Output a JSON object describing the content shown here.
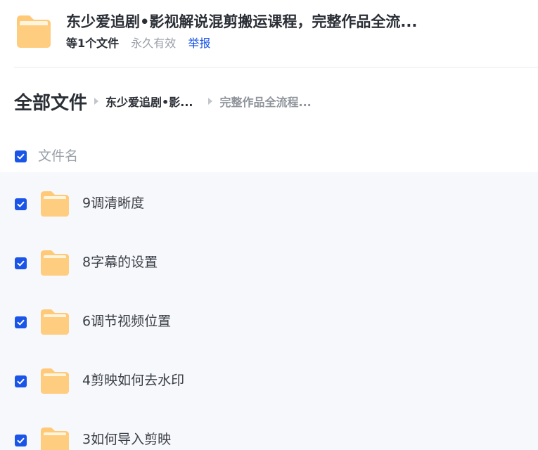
{
  "share": {
    "title": "东少爱追剧•影视解说混剪搬运课程，完整作品全流...",
    "file_count": "等1个文件",
    "expiry": "永久有效",
    "report_label": "举报"
  },
  "breadcrumb": {
    "root": "全部文件",
    "items": [
      "东少爱追剧•影...",
      "完整作品全流程..."
    ]
  },
  "list": {
    "column_name": "文件名",
    "select_all_checked": true,
    "rows": [
      {
        "name": "9调清晰度",
        "checked": true
      },
      {
        "name": "8字幕的设置",
        "checked": true
      },
      {
        "name": "6调节视频位置",
        "checked": true
      },
      {
        "name": "4剪映如何去水印",
        "checked": true
      },
      {
        "name": "3如何导入剪映",
        "checked": true
      }
    ]
  },
  "colors": {
    "accent": "#1a55e8",
    "folder": "#ffc978",
    "row_bg": "#f7f8fc"
  }
}
